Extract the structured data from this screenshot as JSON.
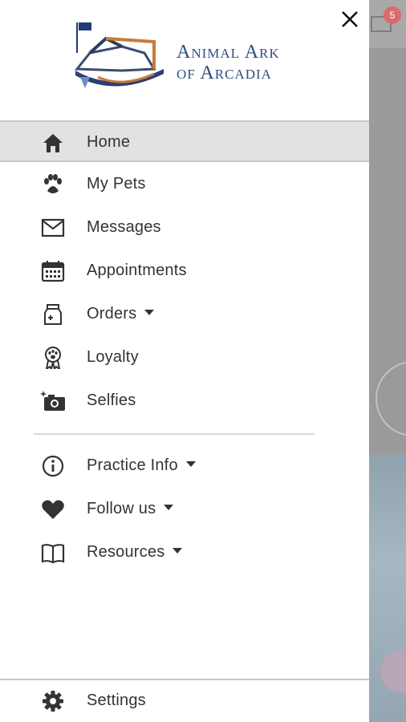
{
  "app": {
    "logo_line1": "Animal Ark",
    "logo_line2": "of Arcadia"
  },
  "backdrop": {
    "badge_count": "5"
  },
  "menu": {
    "items": [
      {
        "label": "Home",
        "icon": "home-icon",
        "active": true
      },
      {
        "label": "My Pets",
        "icon": "paw-icon"
      },
      {
        "label": "Messages",
        "icon": "mail-icon"
      },
      {
        "label": "Appointments",
        "icon": "calendar-icon"
      },
      {
        "label": "Orders",
        "icon": "food-bag-icon",
        "has_dropdown": true
      },
      {
        "label": "Loyalty",
        "icon": "loyalty-ribbon-icon"
      },
      {
        "label": "Selfies",
        "icon": "camera-icon"
      }
    ],
    "secondary": [
      {
        "label": "Practice Info",
        "icon": "info-icon",
        "has_dropdown": true
      },
      {
        "label": "Follow us",
        "icon": "heart-icon",
        "has_dropdown": true
      },
      {
        "label": "Resources",
        "icon": "book-icon",
        "has_dropdown": true
      }
    ],
    "settings": {
      "label": "Settings",
      "icon": "gear-icon"
    }
  },
  "colors": {
    "active_bg": "#e2e2e2",
    "text": "#333333",
    "logo_blue": "#2f4f7f",
    "badge_red": "#d96b6b"
  }
}
